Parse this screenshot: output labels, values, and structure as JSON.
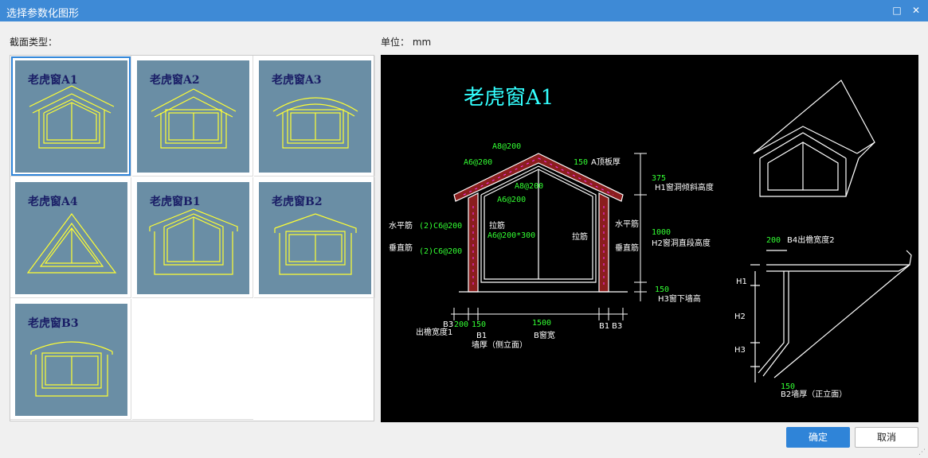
{
  "window": {
    "title": "选择参数化图形",
    "maximize_icon": "□",
    "close_icon": "✕"
  },
  "labels": {
    "section_type": "截面类型：",
    "unit": "单位：  mm"
  },
  "thumbnails": [
    {
      "name": "老虎窗A1",
      "shape": "A1",
      "selected": true
    },
    {
      "name": "老虎窗A2",
      "shape": "A2",
      "selected": false
    },
    {
      "name": "老虎窗A3",
      "shape": "A3",
      "selected": false
    },
    {
      "name": "老虎窗A4",
      "shape": "A4",
      "selected": false
    },
    {
      "name": "老虎窗B1",
      "shape": "B1",
      "selected": false
    },
    {
      "name": "老虎窗B2",
      "shape": "B2",
      "selected": false
    },
    {
      "name": "老虎窗B3",
      "shape": "B3",
      "selected": false
    }
  ],
  "preview": {
    "title": "老虎窗A1",
    "green": {
      "a8_top": "A8@200",
      "a6_left": "A6@200",
      "a8_mid": "A8@200",
      "a6_mid": "A6@200",
      "thick150": "150",
      "h1": "375",
      "h2": "1000",
      "h3": "150",
      "shuiping": "(2)C6@200",
      "chuizhi": "(2)C6@200",
      "lajin_spec": "A6@200*300",
      "b3": "200",
      "b1": "150",
      "b": "1500",
      "b4": "200",
      "b2": "150"
    },
    "white": {
      "a_label": "A顶板厚",
      "h1_label": "H1窗洞倾斜高度",
      "h2_label": "H2窗洞直段高度",
      "h3_label": "H3窗下墙高",
      "shuiping_l": "水平筋",
      "chuizhi_l": "垂直筋",
      "lajin_c": "拉筋",
      "lajin_r": "拉筋",
      "shuiping_r": "水平筋",
      "chuizhi_r": "垂直筋",
      "b3_l": "B3",
      "b3_desc": "出檐宽度1",
      "b1_l": "B1",
      "b1_desc": "墙厚（侧立面）",
      "b_desc": "B窗宽",
      "b1_r": "B1",
      "b3_r": "B3",
      "b4_desc": "B4出檐宽度2",
      "h1_r": "H1",
      "h2_r": "H2",
      "h3_r": "H3",
      "b2_desc": "B2墙厚（正立面）"
    }
  },
  "buttons": {
    "ok": "确定",
    "cancel": "取消"
  }
}
